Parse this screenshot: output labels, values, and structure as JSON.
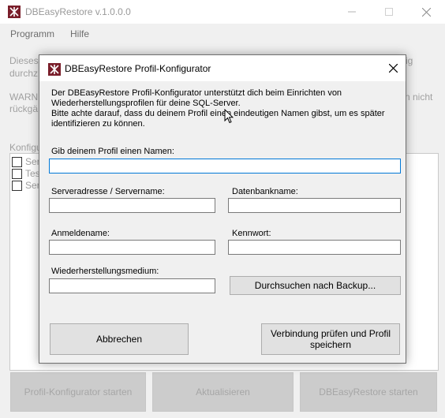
{
  "app": {
    "title": "DBEasyRestore v.1.0.0.0",
    "menu": [
      "Programm",
      "Hilfe"
    ]
  },
  "background": {
    "fragments": [
      "Dieses",
      "durchz",
      "WARN",
      "rückgä",
      "Konfigu"
    ],
    "right_fragments": [
      "ig",
      "n nicht"
    ],
    "list_items": [
      "Ser",
      "Tes",
      "Ser"
    ],
    "buttons": [
      "Profil-Konfigurator starten",
      "Aktualisieren",
      "DBEasyRestore starten"
    ]
  },
  "dialog": {
    "title": "DBEasyRestore Profil-Konfigurator",
    "info_lines": [
      "Der DBEasyRestore Profil-Konfigurator unterstützt dich beim Einrichten von",
      "Wiederherstellungsprofilen für deine SQL-Server.",
      "Bitte achte darauf, dass du deinem Profil einen eindeutigen Namen gibst, um es später",
      "identifizieren zu können."
    ],
    "profile_name": {
      "label": "Gib deinem Profil einen Namen:",
      "value": ""
    },
    "server": {
      "label": "Serveradresse / Servername:",
      "value": ""
    },
    "database": {
      "label": "Datenbankname:",
      "value": ""
    },
    "login": {
      "label": "Anmeldename:",
      "value": ""
    },
    "password": {
      "label": "Kennwort:",
      "value": ""
    },
    "medium": {
      "label": "Wiederherstellungsmedium:",
      "value": ""
    },
    "browse_label": "Durchsuchen nach Backup...",
    "cancel_label": "Abbrechen",
    "save_label_line1": "Verbindung prüfen und Profil",
    "save_label_line2": "speichern"
  }
}
